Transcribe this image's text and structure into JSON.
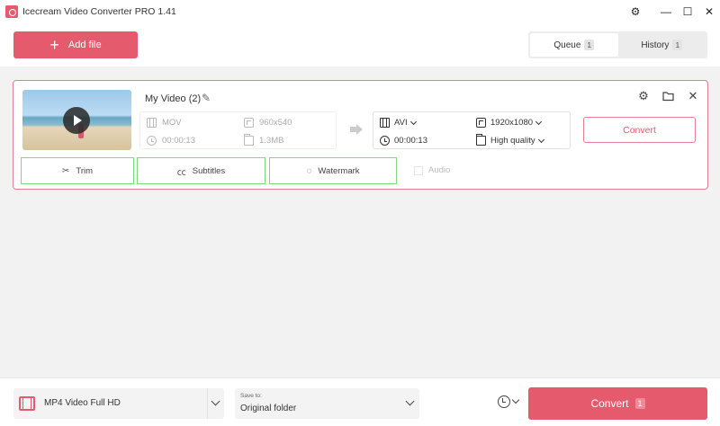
{
  "app": {
    "title": "Icecream Video Converter PRO 1.41"
  },
  "window": {
    "settings_icon": "gear-icon",
    "minimize_icon": "minimize-icon",
    "maximize_icon": "maximize-icon",
    "close_icon": "close-icon"
  },
  "header": {
    "add_file_label": "Add file",
    "tabs": [
      {
        "label": "Queue",
        "count": "1",
        "active": true
      },
      {
        "label": "History",
        "count": "1",
        "active": false
      }
    ]
  },
  "item": {
    "name": "My Video (2)",
    "source": {
      "format": "MOV",
      "resolution": "960x540",
      "duration": "00:00:13",
      "size": "1.3MB"
    },
    "target": {
      "format": "AVI",
      "resolution": "1920x1080",
      "duration": "00:00:13",
      "quality": "High quality"
    },
    "convert_label": "Convert",
    "actions": {
      "trim": "Trim",
      "subtitles": "Subtitles",
      "watermark": "Watermark",
      "audio": "Audio"
    }
  },
  "footer": {
    "preset": "MP4 Video Full HD",
    "save_to_label": "Save to:",
    "save_to_value": "Original folder",
    "convert_label": "Convert",
    "convert_count": "1"
  },
  "colors": {
    "accent": "#e65a6e",
    "highlight": "#7fd97f"
  }
}
